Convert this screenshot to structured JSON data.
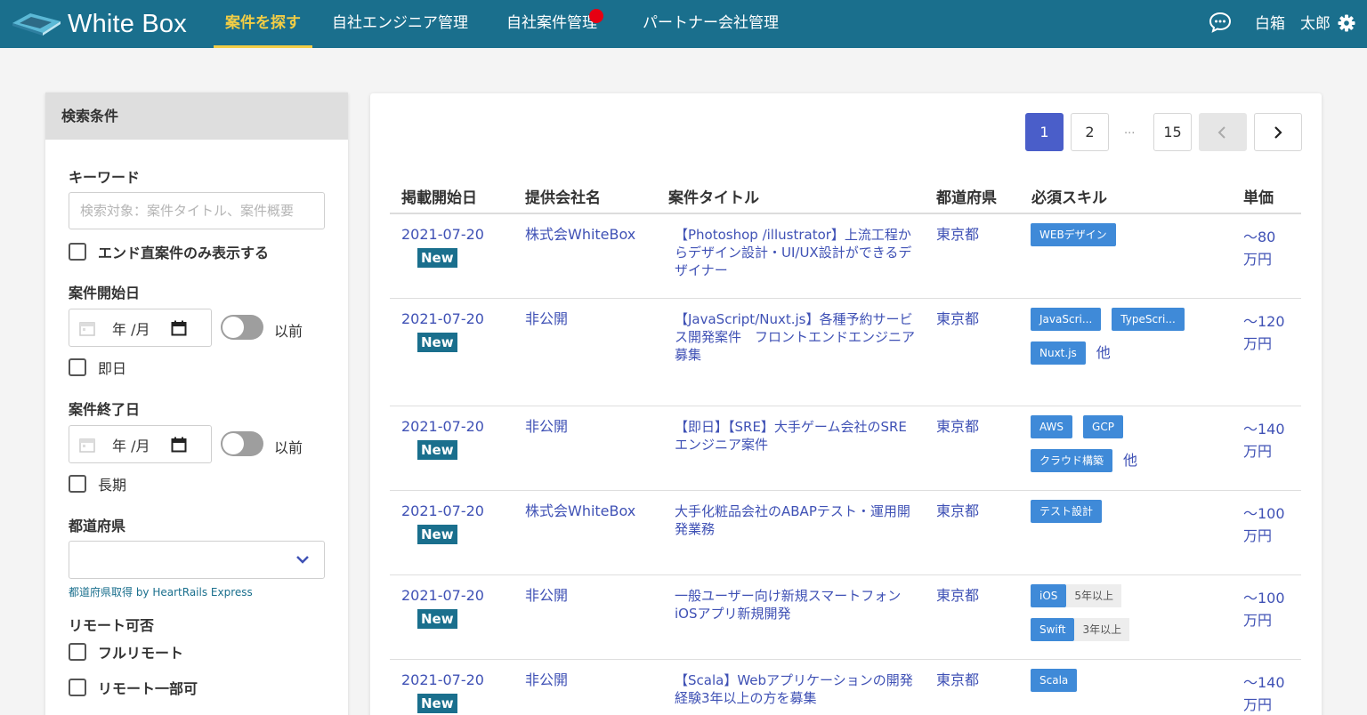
{
  "header": {
    "logo_text": "White Box",
    "nav": [
      {
        "label": "案件を探す"
      },
      {
        "label": "自社エンジニア管理"
      },
      {
        "label": "自社案件管理"
      },
      {
        "label": "パートナー会社管理"
      }
    ],
    "user_last": "白箱",
    "user_first": "太郎",
    "accent": "#f2cd45",
    "bg": "#1a6f8d"
  },
  "sidebar": {
    "title": "検索条件",
    "keyword_label": "キーワード",
    "keyword_placeholder": "検索対象：案件タイトル、案件概要",
    "end_direct_label": "エンド直案件のみ表示する",
    "start_date_label": "案件開始日",
    "start_date_text": "年 /月",
    "start_toggle_label": "以前",
    "immediate_label": "即日",
    "end_date_label": "案件終了日",
    "end_date_text": "年 /月",
    "end_toggle_label": "以前",
    "long_term_label": "長期",
    "prefecture_label": "都道府県",
    "prefecture_credit": "都道府県取得 by HeartRails Express",
    "remote_label": "リモート可否",
    "full_remote_label": "フルリモート",
    "partial_remote_label": "リモート一部可"
  },
  "pagination": {
    "pages": [
      "1",
      "2",
      "15"
    ],
    "current": "1",
    "ellipsis": "..."
  },
  "table": {
    "headers": [
      "掲載開始日",
      "提供会社名",
      "案件タイトル",
      "都道府県",
      "必須スキル",
      "単価"
    ],
    "new_label": "New",
    "other_label": "他",
    "rows": [
      {
        "date": "2021-07-20",
        "company": "株式会WhiteBox",
        "title": "【Photoshop /illustrator】上流工程からデザイン設計・UI/UX設計ができるデザイナー",
        "pref": "東京都",
        "skill_lines": [
          [
            {
              "name": "WEBデザイン"
            }
          ]
        ],
        "has_other": false,
        "price1": "〜80",
        "price2": "万円"
      },
      {
        "date": "2021-07-20",
        "company": "非公開",
        "title": "【JavaScript/Nuxt.js】各種予約サービス開発案件　フロントエンドエンジニア募集",
        "pref": "東京都",
        "skill_lines": [
          [
            {
              "name": "JavaScri..."
            },
            {
              "name": "TypeScri..."
            }
          ],
          [
            {
              "name": "Nuxt.js"
            }
          ]
        ],
        "has_other": true,
        "price1": "〜120",
        "price2": "万円"
      },
      {
        "date": "2021-07-20",
        "company": "非公開",
        "title": "【即日】【SRE】大手ゲーム会社のSREエンジニア案件",
        "pref": "東京都",
        "skill_lines": [
          [
            {
              "name": "AWS"
            },
            {
              "name": "GCP"
            }
          ],
          [
            {
              "name": "クラウド構築"
            }
          ]
        ],
        "has_other": true,
        "price1": "〜140",
        "price2": "万円"
      },
      {
        "date": "2021-07-20",
        "company": "株式会WhiteBox",
        "title": "大手化粧品会社のABAPテスト・運用開発業務",
        "pref": "東京都",
        "skill_lines": [
          [
            {
              "name": "テスト設計"
            }
          ]
        ],
        "has_other": false,
        "price1": "〜100",
        "price2": "万円"
      },
      {
        "date": "2021-07-20",
        "company": "非公開",
        "title": "一般ユーザー向け新規スマートフォンiOSアプリ新規開発",
        "pref": "東京都",
        "skill_lines": [
          [
            {
              "name": "iOS",
              "years": "5年以上"
            }
          ],
          [
            {
              "name": "Swift",
              "years": "3年以上"
            }
          ]
        ],
        "has_other": false,
        "price1": "〜100",
        "price2": "万円"
      },
      {
        "date": "2021-07-20",
        "company": "非公開",
        "title": "【Scala】Webアプリケーションの開発経験3年以上の方を募集",
        "pref": "東京都",
        "skill_lines": [
          [
            {
              "name": "Scala"
            }
          ]
        ],
        "has_other": false,
        "price1": "〜140",
        "price2": "万円"
      }
    ]
  }
}
